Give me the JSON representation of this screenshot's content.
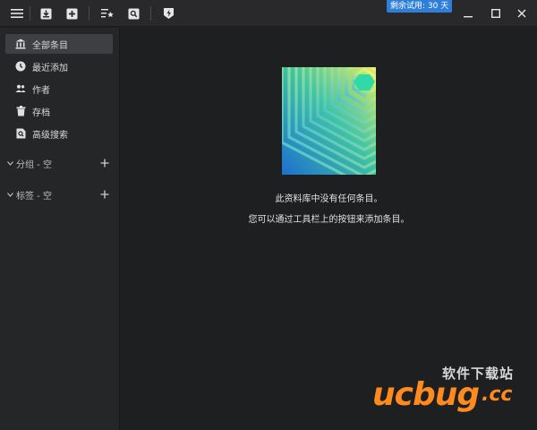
{
  "titlebar": {
    "trial_badge": "剩余试用: 30 天",
    "icons": [
      "menu-icon",
      "import-icon",
      "add-icon",
      "sort-favorite-icon",
      "search-icon",
      "lightning-icon"
    ],
    "window_controls": [
      "minimize-icon",
      "maximize-icon",
      "close-icon"
    ]
  },
  "sidebar": {
    "items": [
      {
        "label": "全部条目",
        "icon": "bank-icon",
        "active": true
      },
      {
        "label": "最近添加",
        "icon": "clock-icon",
        "active": false
      },
      {
        "label": "作者",
        "icon": "people-icon",
        "active": false
      },
      {
        "label": "存档",
        "icon": "trash-icon",
        "active": false
      },
      {
        "label": "高级搜索",
        "icon": "doc-search-icon",
        "active": false
      }
    ],
    "sections": [
      {
        "label": "分组 - 空"
      },
      {
        "label": "标签 - 空"
      }
    ]
  },
  "main": {
    "empty_line1": "此资料库中没有任何条目。",
    "empty_line2": "您可以通过工具栏上的按钮来添加条目。"
  },
  "watermark": {
    "cn_text": "软件下载站",
    "logo": "ucbug",
    "domain": ".cc"
  },
  "colors": {
    "accent": "#2f7fd8",
    "sidebar_bg": "#252628",
    "main_bg": "#1e1f20",
    "watermark_orange": "#ff8a1f"
  }
}
